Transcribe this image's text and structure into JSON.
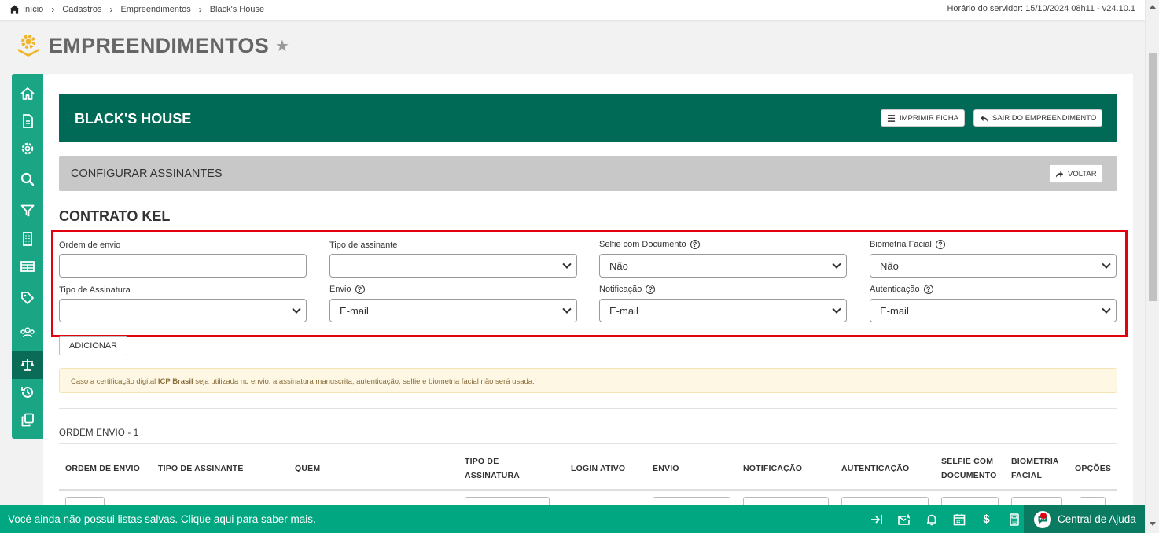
{
  "breadcrumb": {
    "items": [
      "Início",
      "Cadastros",
      "Empreendimentos",
      "Black's House"
    ],
    "server_time": "Horário do servidor: 15/10/2024 08h11 - v24.10.1"
  },
  "page": {
    "title": "EMPREENDIMENTOS"
  },
  "banner": {
    "title": "BLACK'S HOUSE",
    "print_label": "IMPRIMIR FICHA",
    "exit_label": "SAIR DO EMPREENDIMENTO"
  },
  "subbar": {
    "title": "CONFIGURAR ASSINANTES",
    "back_label": "VOLTAR"
  },
  "section": {
    "title": "CONTRATO KEL"
  },
  "form": {
    "ordem_envio": {
      "label": "Ordem de envio",
      "value": ""
    },
    "tipo_assinante": {
      "label": "Tipo de assinante",
      "value": ""
    },
    "selfie_documento": {
      "label": "Selfie com Documento",
      "value": "Não"
    },
    "biometria_facial": {
      "label": "Biometria Facial",
      "value": "Não"
    },
    "tipo_assinatura": {
      "label": "Tipo de Assinatura",
      "value": ""
    },
    "envio": {
      "label": "Envio",
      "value": "E-mail"
    },
    "notificacao": {
      "label": "Notificação",
      "value": "E-mail"
    },
    "autenticacao": {
      "label": "Autenticação",
      "value": "E-mail"
    },
    "add_label": "ADICIONAR"
  },
  "alert": {
    "prefix": "Caso a certificação digital ",
    "bold": "ICP Brasil",
    "suffix": " seja utilizada no envio, a assinatura manuscrita, autenticação, selfie e biometria facial não será usada."
  },
  "order_section": {
    "label": "ORDEM ENVIO - 1"
  },
  "table": {
    "headers": [
      "ORDEM DE ENVIO",
      "TIPO DE ASSINANTE",
      "QUEM",
      "TIPO DE ASSINATURA",
      "LOGIN ATIVO",
      "ENVIO",
      "NOTIFICAÇÃO",
      "AUTENTICAÇÃO",
      "SELFIE COM DOCUMENTO",
      "BIOMETRIA FACIAL",
      "OPÇÕES"
    ]
  },
  "footer": {
    "message": "Você ainda não possui listas salvas. Clique aqui para saber mais.",
    "help_center": "Central de Ajuda"
  },
  "colors": {
    "brand_dark": "#006a57",
    "brand": "#1aa584",
    "footer": "#00a781",
    "highlight_border": "#e3000f"
  }
}
